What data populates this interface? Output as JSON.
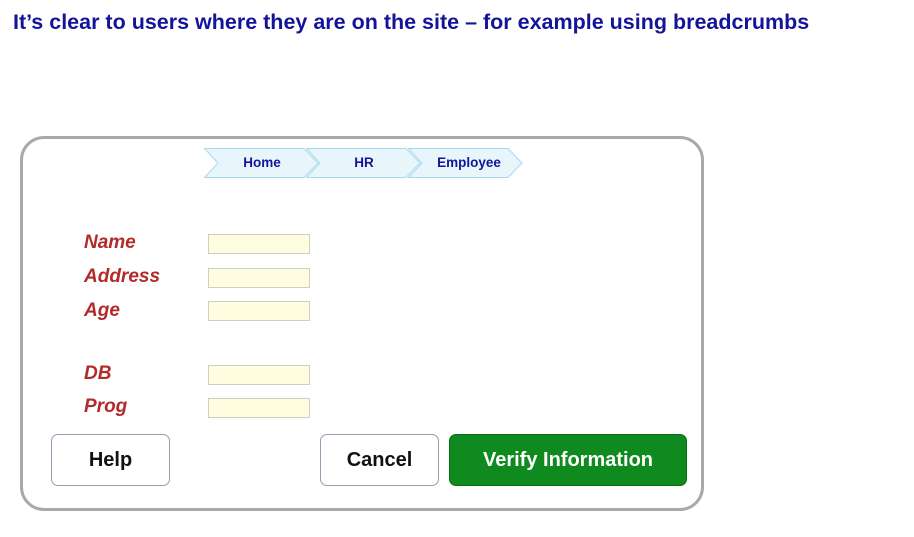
{
  "slide": {
    "title": "It’s clear to users where they are on the site – for example using breadcrumbs"
  },
  "breadcrumb": {
    "items": [
      {
        "label": "Home"
      },
      {
        "label": "HR"
      },
      {
        "label": "Employee"
      }
    ]
  },
  "form": {
    "fields": [
      {
        "label": "Name",
        "value": ""
      },
      {
        "label": "Address",
        "value": ""
      },
      {
        "label": "Age",
        "value": ""
      },
      {
        "label": "DB",
        "value": ""
      },
      {
        "label": "Prog",
        "value": ""
      }
    ]
  },
  "buttons": {
    "help": "Help",
    "cancel": "Cancel",
    "verify": "Verify Information"
  },
  "colors": {
    "title": "#14149a",
    "label": "#b22a2a",
    "input_bg": "#fffde0",
    "crumb_fill": "#e8f6fc",
    "primary": "#0f8a1e",
    "panel_border": "#a9a9a9"
  }
}
